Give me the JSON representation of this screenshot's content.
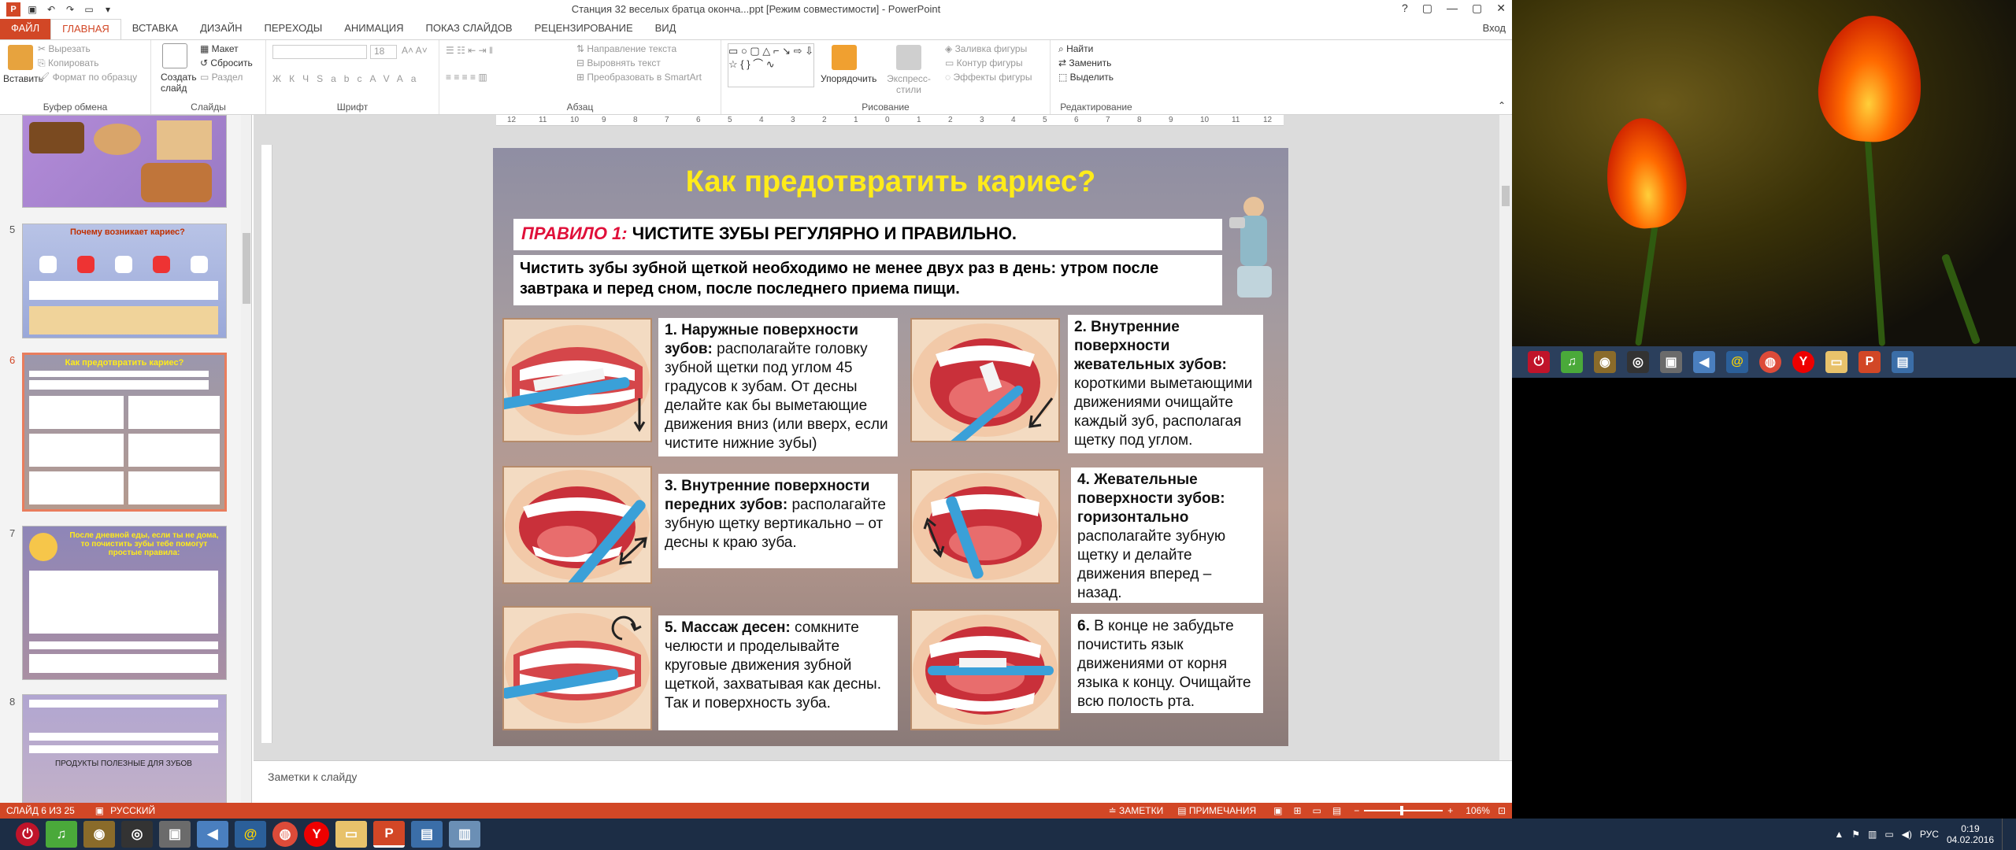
{
  "window": {
    "title": "Станция 32 веселых братца оконча...ppt [Режим совместимости] - PowerPoint",
    "signin": "Вход",
    "controls": [
      "?",
      "▢",
      "—",
      "▢",
      "✕"
    ]
  },
  "tabs": [
    "ФАЙЛ",
    "ГЛАВНАЯ",
    "ВСТАВКА",
    "ДИЗАЙН",
    "ПЕРЕХОДЫ",
    "АНИМАЦИЯ",
    "ПОКАЗ СЛАЙДОВ",
    "РЕЦЕНЗИРОВАНИЕ",
    "ВИД"
  ],
  "ribbon": {
    "clipboard": {
      "paste": "Вставить",
      "cut": "Вырезать",
      "copy": "Копировать",
      "format": "Формат по образцу",
      "label": "Буфер обмена"
    },
    "slides": {
      "create": "Создать слайд",
      "layout": "Макет",
      "reset": "Сбросить",
      "section": "Раздел",
      "label": "Слайды"
    },
    "font": {
      "size": "18",
      "label": "Шрифт",
      "buttons": [
        "Ж",
        "К",
        "Ч",
        "S",
        "abc",
        "AV",
        "Aa"
      ]
    },
    "paragraph": {
      "direction": "Направление текста",
      "align": "Выровнять текст",
      "smartart": "Преобразовать в SmartArt",
      "label": "Абзац"
    },
    "drawing": {
      "arrange": "Упорядочить",
      "styles": "Экспресс-стили",
      "fill": "Заливка фигуры",
      "outline": "Контур фигуры",
      "effects": "Эффекты фигуры",
      "label": "Рисование"
    },
    "editing": {
      "find": "Найти",
      "replace": "Заменить",
      "select": "Выделить",
      "label": "Редактирование"
    }
  },
  "thumbnails": [
    {
      "num": "5",
      "title": "Почему возникает кариес?"
    },
    {
      "num": "6",
      "title": "Как предотвратить кариес?"
    },
    {
      "num": "7",
      "title": "После дневной еды, если ты не дома, то почистить зубы тебе помогут простые правила:"
    },
    {
      "num": "8",
      "title": "ПРОДУКТЫ ПОЛЕЗНЫЕ ДЛЯ ЗУБОВ"
    }
  ],
  "ruler_labels": [
    "12",
    "11",
    "10",
    "9",
    "8",
    "7",
    "6",
    "5",
    "4",
    "3",
    "2",
    "1",
    "0",
    "1",
    "2",
    "3",
    "4",
    "5",
    "6",
    "7",
    "8",
    "9",
    "10",
    "11",
    "12"
  ],
  "slide": {
    "title": "Как предотвратить кариес?",
    "rule_label": "ПРАВИЛО 1:",
    "rule_text": " ЧИСТИТЕ ЗУБЫ РЕГУЛЯРНО И ПРАВИЛЬНО.",
    "intro": "Чистить зубы зубной щеткой необходимо не менее двух раз в день: утром после завтрака и перед сном, после последнего приема пищи.",
    "tips": [
      {
        "bold": "1. Наружные поверхности зубов:",
        "text": " располагайте головку зубной щетки под углом 45 градусов к зубам. От десны делайте как бы выметающие движения вниз (или вверх, если чистите нижние зубы)"
      },
      {
        "bold": "2. Внутренние поверхности жевательных зубов:",
        "text": " короткими выметающими движениями очищайте каждый зуб, располагая щетку под углом."
      },
      {
        "bold": "3. Внутренние поверхности передних зубов:",
        "text": " располагайте зубную щетку вертикально – от десны к краю зуба."
      },
      {
        "bold": "4. Жевательные поверхности зубов: горизонтально",
        "text": " располагайте зубную щетку и делайте движения вперед – назад."
      },
      {
        "bold": "5. Массаж десен:",
        "text": " сомкните челюсти и проделывайте круговые движения зубной щеткой, захватывая как десны. Так и поверхность зуба."
      },
      {
        "bold": "6.",
        "text": " В конце не забудьте почистить язык движениями от корня языка к концу. Очищайте всю полость рта."
      }
    ]
  },
  "notes_placeholder": "Заметки к слайду",
  "status": {
    "slide_of": "СЛАЙД 6 ИЗ 25",
    "language": "РУССКИЙ",
    "notes": "ЗАМЕТКИ",
    "comments": "ПРИМЕЧАНИЯ",
    "zoom": "106%"
  },
  "clock": {
    "time": "0:19",
    "date": "04.02.2016",
    "lang": "РУС"
  },
  "colors": {
    "accent": "#d24726",
    "title_yellow": "#ffeb1a",
    "rule_red": "#e0103a",
    "taskbar": "#1c2d45"
  }
}
